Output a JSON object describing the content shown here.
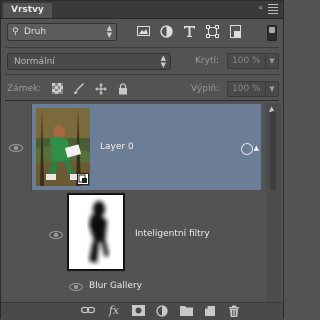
{
  "panel": {
    "tab_label": "Vrstvy",
    "collapse_icon": "double-chevron-left-icon",
    "menu_icon": "panel-menu-icon"
  },
  "filter": {
    "kind_label": "Druh",
    "search_icon": "search-icon",
    "icons": [
      "image-filter-icon",
      "adjustment-filter-icon",
      "type-filter-icon",
      "shape-filter-icon",
      "smart-object-filter-icon"
    ]
  },
  "blend": {
    "mode": "Normální",
    "opacity_label": "Krytí:",
    "opacity_value": "100 %"
  },
  "lock": {
    "label": "Zámek:",
    "icons": [
      "lock-transparency-icon",
      "lock-pixels-icon",
      "lock-position-icon",
      "lock-all-icon"
    ],
    "fill_label": "Výplň:",
    "fill_value": "100 %"
  },
  "layers": [
    {
      "name": "Layer 0",
      "selected": true,
      "visible": true,
      "type": "smart-object"
    }
  ],
  "smart_filters": {
    "mask_label": "Inteligentní filtry",
    "filters": [
      {
        "name": "Blur Gallery",
        "visible": true
      }
    ]
  },
  "bottom_toolbar": {
    "icons": [
      "link-layers-icon",
      "fx-icon",
      "layer-mask-icon",
      "adjustment-layer-icon",
      "new-group-icon",
      "new-layer-icon",
      "trash-icon"
    ],
    "fx_label": "fx"
  },
  "colors": {
    "panel_bg": "#535353",
    "selection_bg": "#6c7e97",
    "tab_bar": "#3a3a3a"
  }
}
